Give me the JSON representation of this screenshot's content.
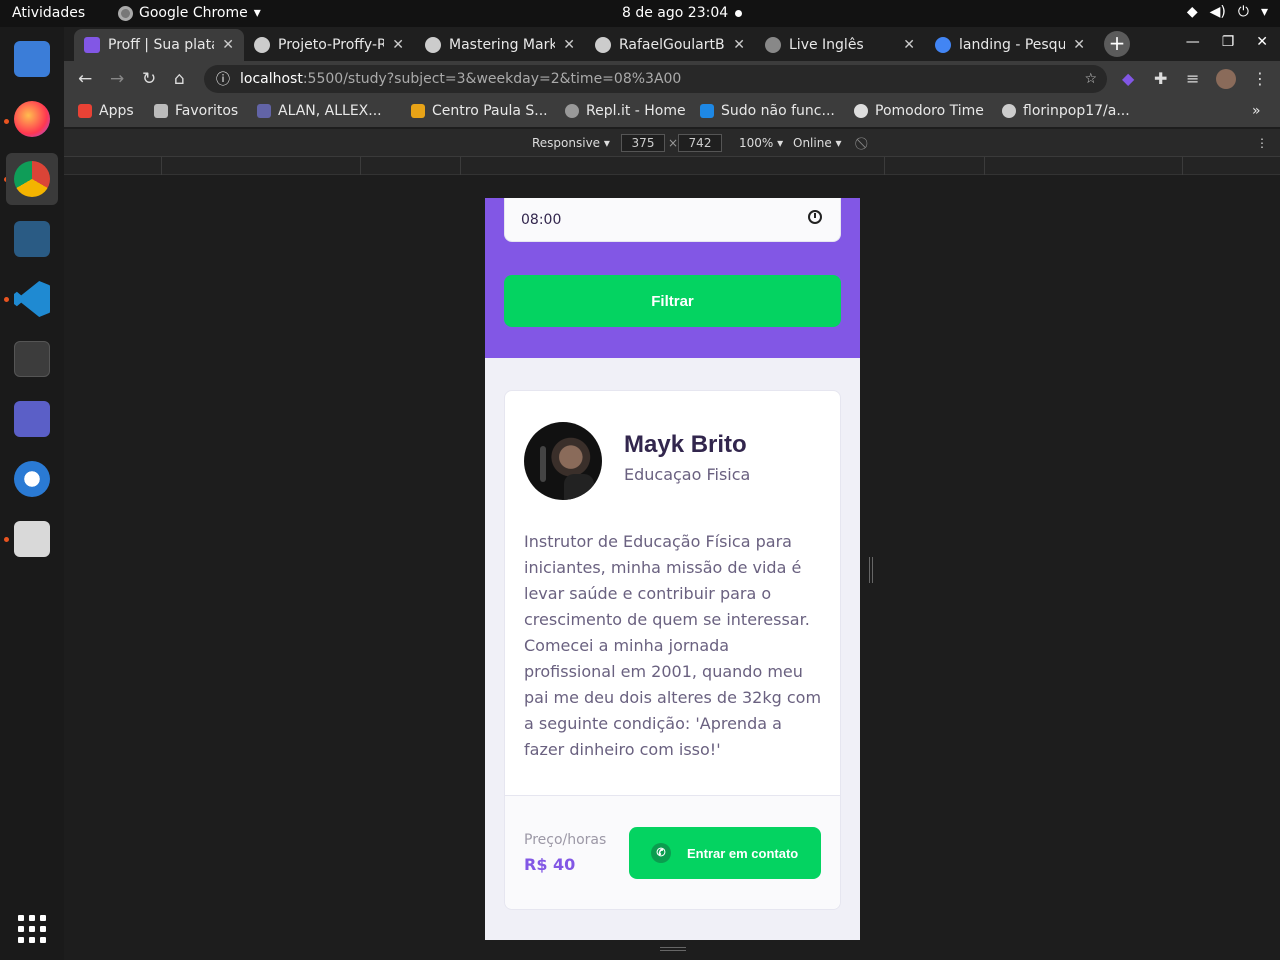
{
  "topbar": {
    "activities": "Atividades",
    "app_name": "Google Chrome",
    "datetime": "8 de ago  23:04"
  },
  "tabs": [
    {
      "title": "Proff | Sua plata",
      "icon_color": "#8257e5",
      "active": true
    },
    {
      "title": "Projeto-Proffy-R",
      "icon_color": "#cccccc",
      "active": false
    },
    {
      "title": "Mastering Mark",
      "icon_color": "#cccccc",
      "active": false
    },
    {
      "title": "RafaelGoulartB",
      "icon_color": "#cccccc",
      "active": false
    },
    {
      "title": "Live Inglês",
      "icon_color": "#888888",
      "active": false
    },
    {
      "title": "landing - Pesqu",
      "icon_color": "#4285f4",
      "active": false
    }
  ],
  "url": {
    "host": "localhost",
    "path": ":5500/study?subject=3&weekday=2&time=08%3A00"
  },
  "bookmarks": [
    {
      "label": "Apps",
      "color": "#e94235"
    },
    {
      "label": "Favoritos",
      "color": "#bbbbbb"
    },
    {
      "label": "ALAN, ALLEX...",
      "color": "#6264a7"
    },
    {
      "label": "Centro Paula S...",
      "color": "#e8a317"
    },
    {
      "label": "Repl.it - Home",
      "color": "#999999"
    },
    {
      "label": "Sudo não func...",
      "color": "#1e88e5"
    },
    {
      "label": "Pomodoro Time",
      "color": "#dddddd"
    },
    {
      "label": "florinpop17/a...",
      "color": "#cccccc"
    }
  ],
  "devtools": {
    "device": "Responsive",
    "width": "375",
    "height": "742",
    "zoom": "100%",
    "network": "Online"
  },
  "page": {
    "time_value": "08:00",
    "filter_label": "Filtrar",
    "teacher": {
      "name": "Mayk Brito",
      "subject": "Educaçao Fisica",
      "bio": "Instrutor de Educação Física para iniciantes, minha missão de vida é levar saúde e contribuir para o crescimento de quem se interessar. Comecei a minha jornada profissional em 2001, quando meu pai me deu dois alteres de 32kg com a seguinte condição: 'Aprenda a fazer dinheiro com isso!'",
      "price_label": "Preço/horas",
      "price_value": "R$ 40",
      "contact_label": "Entrar em contato"
    }
  }
}
